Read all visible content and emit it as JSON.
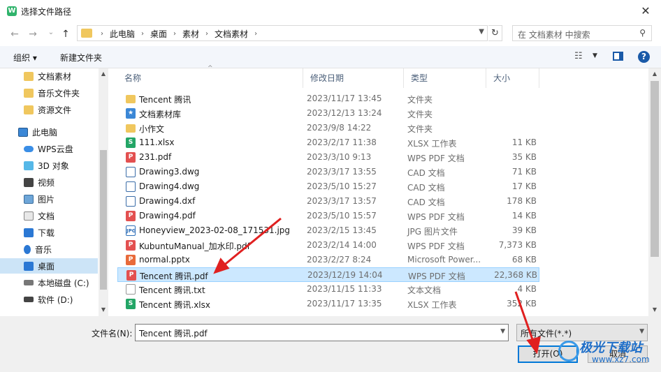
{
  "window": {
    "title": "选择文件路径",
    "close_symbol": "✕"
  },
  "nav": {
    "back_symbol": "←",
    "forward_symbol": "→",
    "recent_symbol": "⌄",
    "up_symbol": "↑",
    "breadcrumbs": [
      "此电脑",
      "桌面",
      "素材",
      "文档素材"
    ],
    "breadcrumb_sep": "›",
    "refresh_symbol": "↻",
    "search_placeholder": "在 文档素材 中搜索"
  },
  "toolbar": {
    "organize": "组织 ▾",
    "new_folder": "新建文件夹",
    "help": "?"
  },
  "sidebar": {
    "items": [
      {
        "label": "文档素材",
        "icon": "folder-icon"
      },
      {
        "label": "音乐文件夹",
        "icon": "folder-icon"
      },
      {
        "label": "资源文件",
        "icon": "folder-icon"
      },
      {
        "label": "此电脑",
        "icon": "pc-icon"
      },
      {
        "label": "WPS云盘",
        "icon": "cloud-icon"
      },
      {
        "label": "3D 对象",
        "icon": "cube-icon"
      },
      {
        "label": "视频",
        "icon": "video-icon"
      },
      {
        "label": "图片",
        "icon": "picture-icon"
      },
      {
        "label": "文档",
        "icon": "document-icon"
      },
      {
        "label": "下载",
        "icon": "download-icon"
      },
      {
        "label": "音乐",
        "icon": "music-icon"
      },
      {
        "label": "桌面",
        "icon": "desktop-icon"
      },
      {
        "label": "本地磁盘 (C:)",
        "icon": "disk-icon"
      },
      {
        "label": "软件 (D:)",
        "icon": "disk-icon"
      }
    ],
    "selected_index": 11
  },
  "columns": {
    "name": "名称",
    "date": "修改日期",
    "type": "类型",
    "size": "大小"
  },
  "files": [
    {
      "name": "Tencent 腾讯",
      "date": "2023/11/17 13:45",
      "type": "文件夹",
      "size": "",
      "kind": "folder"
    },
    {
      "name": "文档素材库",
      "date": "2023/12/13 13:24",
      "type": "文件夹",
      "size": "",
      "kind": "lib"
    },
    {
      "name": "小作文",
      "date": "2023/9/8 14:22",
      "type": "文件夹",
      "size": "",
      "kind": "folder"
    },
    {
      "name": "111.xlsx",
      "date": "2023/2/17 11:38",
      "type": "XLSX 工作表",
      "size": "11 KB",
      "kind": "xlsx"
    },
    {
      "name": "231.pdf",
      "date": "2023/3/10 9:13",
      "type": "WPS PDF 文档",
      "size": "35 KB",
      "kind": "pdf"
    },
    {
      "name": "Drawing3.dwg",
      "date": "2023/3/17 13:55",
      "type": "CAD 文档",
      "size": "71 KB",
      "kind": "dwg"
    },
    {
      "name": "Drawing4.dwg",
      "date": "2023/5/10 15:27",
      "type": "CAD 文档",
      "size": "17 KB",
      "kind": "dwg"
    },
    {
      "name": "Drawing4.dxf",
      "date": "2023/3/17 13:57",
      "type": "CAD 文档",
      "size": "178 KB",
      "kind": "dwg"
    },
    {
      "name": "Drawing4.pdf",
      "date": "2023/5/10 15:57",
      "type": "WPS PDF 文档",
      "size": "14 KB",
      "kind": "pdf"
    },
    {
      "name": "Honeyview_2023-02-08_171531.jpg",
      "date": "2023/2/15 13:45",
      "type": "JPG 图片文件",
      "size": "39 KB",
      "kind": "jpg"
    },
    {
      "name": "KubuntuManual_加水印.pdf",
      "date": "2023/2/14 14:00",
      "type": "WPS PDF 文档",
      "size": "7,373 KB",
      "kind": "pdf"
    },
    {
      "name": "normal.pptx",
      "date": "2023/2/27 8:24",
      "type": "Microsoft Power...",
      "size": "68 KB",
      "kind": "ppt"
    },
    {
      "name": "Tencent 腾讯.pdf",
      "date": "2023/12/19 14:04",
      "type": "WPS PDF 文档",
      "size": "22,368 KB",
      "kind": "pdf"
    },
    {
      "name": "Tencent 腾讯.txt",
      "date": "2023/11/15 11:33",
      "type": "文本文档",
      "size": "4 KB",
      "kind": "txt"
    },
    {
      "name": "Tencent 腾讯.xlsx",
      "date": "2023/11/17 13:35",
      "type": "XLSX 工作表",
      "size": "352 KB",
      "kind": "xlsx"
    }
  ],
  "selected_file_index": 12,
  "bottom": {
    "filename_label": "文件名(N):",
    "filename_value": "Tencent 腾讯.pdf",
    "filter_value": "所有文件(*.*)",
    "open_label": "打开(O)",
    "cancel_label": "取消"
  },
  "watermark": {
    "text": "极光下载站",
    "url": "www.xz7.com"
  },
  "colors": {
    "accent": "#0078d7",
    "selection": "#cce8ff",
    "annotation_arrow": "#e02020"
  }
}
